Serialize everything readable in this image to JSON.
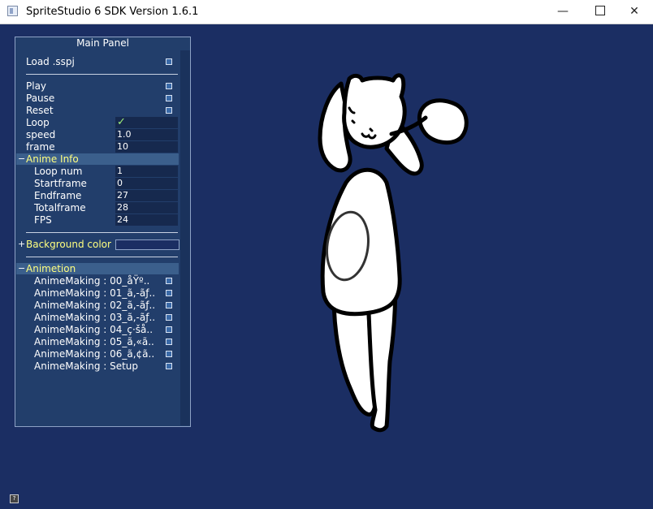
{
  "window": {
    "title": "SpriteStudio 6 SDK Version 1.6.1",
    "minimize_symbol": "—",
    "close_symbol": "✕"
  },
  "panel": {
    "title": "Main Panel",
    "load_label": "Load .sspj",
    "play_label": "Play",
    "pause_label": "Pause",
    "reset_label": "Reset",
    "loop_label": "Loop",
    "loop_checked": true,
    "loop_check_symbol": "✓",
    "speed_label": "speed",
    "speed_value": "1.0",
    "frame_label": "frame",
    "frame_value": "10",
    "anime_info": {
      "toggle": "−",
      "title": "Anime Info",
      "loop_num_label": "Loop num",
      "loop_num_value": "1",
      "startframe_label": "Startframe",
      "startframe_value": "0",
      "endframe_label": "Endframe",
      "endframe_value": "27",
      "totalframe_label": "Totalframe",
      "totalframe_value": "28",
      "fps_label": "FPS",
      "fps_value": "24"
    },
    "background": {
      "toggle": "+",
      "label": "Background color",
      "color": "#1b2e63"
    },
    "animation": {
      "toggle": "−",
      "title": "Animetion",
      "items": [
        "AnimeMaking : 00_åŸº..",
        "AnimeMaking : 01_ã,-ãƒ..",
        "AnimeMaking : 02_ã,-ãƒ..",
        "AnimeMaking : 03_ã,-ãƒ..",
        "AnimeMaking : 04_ç·šå..",
        "AnimeMaking : 05_ã,«ã..",
        "AnimeMaking : 06_ã,¢ã..",
        "AnimeMaking : Setup"
      ]
    }
  },
  "colors": {
    "background": "#1b2e63",
    "panel": "#26446e",
    "section_header": "#3b5f8c",
    "yellow_text": "#ffff80",
    "checkmark": "#9ff07a"
  }
}
